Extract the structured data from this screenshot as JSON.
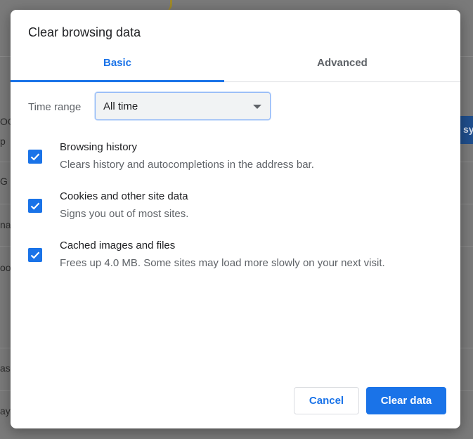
{
  "background": {
    "fragments": [
      "OO",
      "p",
      "G",
      "na",
      "oo",
      "ass",
      "ayn"
    ],
    "blue_fragment": "sy"
  },
  "dialog": {
    "title": "Clear browsing data",
    "tabs": [
      {
        "label": "Basic",
        "selected": true
      },
      {
        "label": "Advanced",
        "selected": false
      }
    ],
    "time_range": {
      "label": "Time range",
      "selected": "All time"
    },
    "options": [
      {
        "title": "Browsing history",
        "description": "Clears history and autocompletions in the address bar.",
        "checked": true
      },
      {
        "title": "Cookies and other site data",
        "description": "Signs you out of most sites.",
        "checked": true
      },
      {
        "title": "Cached images and files",
        "description": "Frees up 4.0 MB. Some sites may load more slowly on your next visit.",
        "checked": true
      }
    ],
    "buttons": {
      "cancel": "Cancel",
      "clear": "Clear data"
    }
  },
  "colors": {
    "accent": "#1a73e8",
    "text_primary": "#202124",
    "text_secondary": "#5f6368"
  }
}
